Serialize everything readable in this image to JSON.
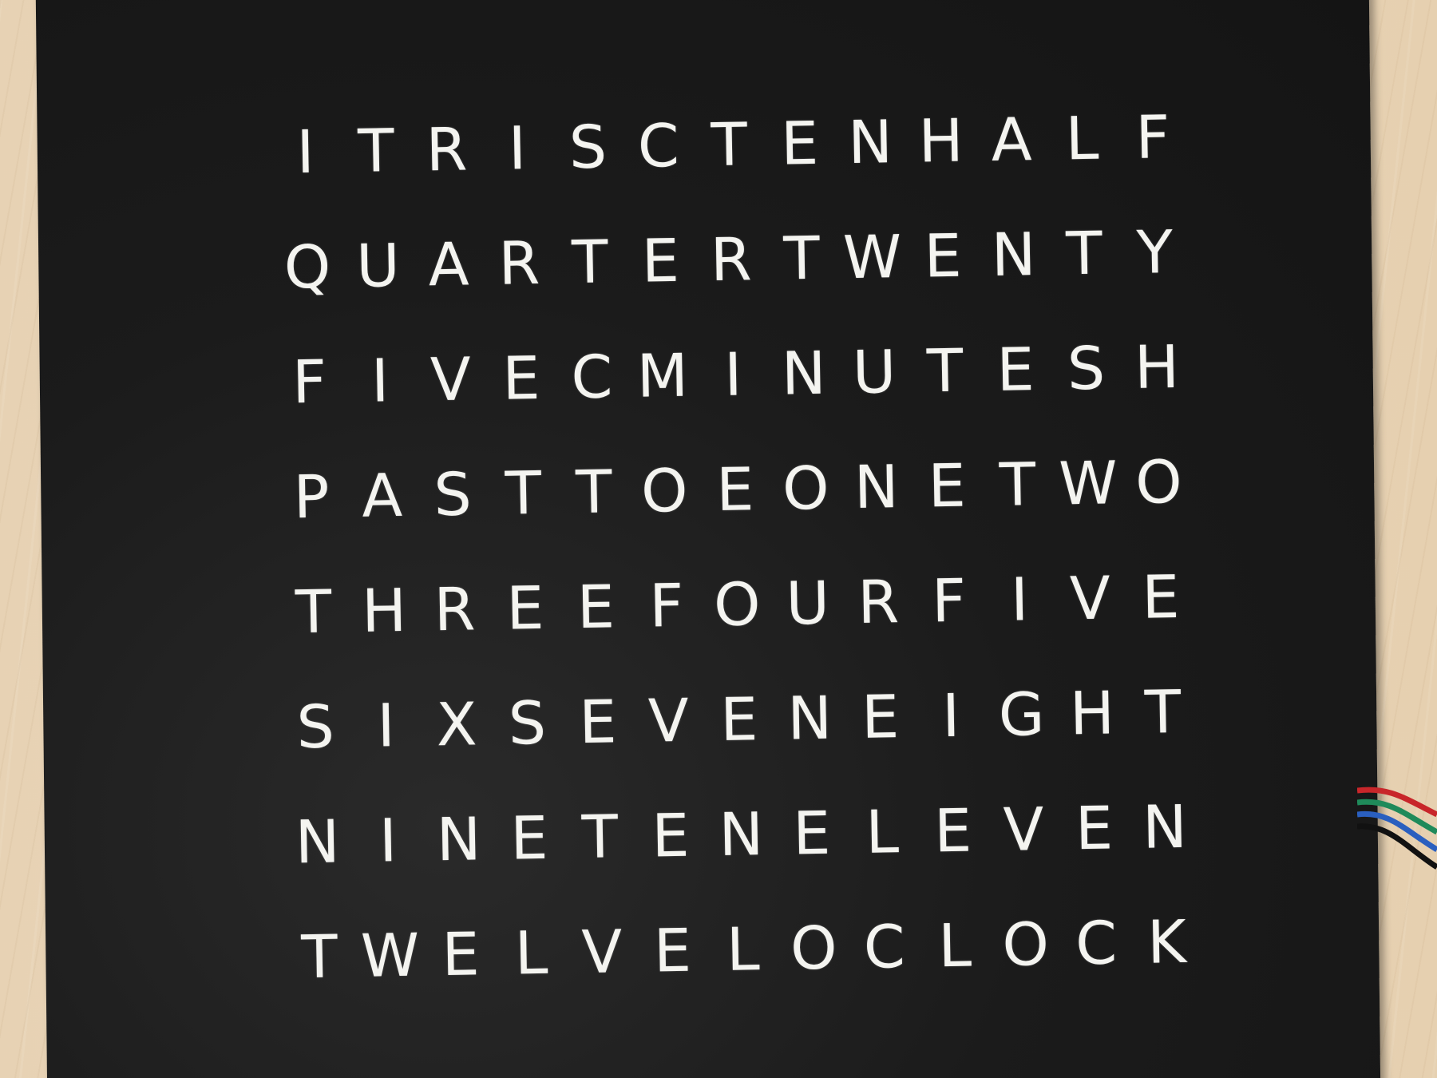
{
  "scene": {
    "description_colors": {
      "panel": "#1b1b1b",
      "letters": "#f4f4f0",
      "table": "#e7d2b4"
    },
    "wire_colors": [
      "#c8262a",
      "#1f8a5a",
      "#2a5fbf",
      "#111111"
    ]
  },
  "clock": {
    "rows": [
      [
        "I",
        "T",
        "R",
        "I",
        "S",
        "C",
        "T",
        "E",
        "N",
        "H",
        "A",
        "L",
        "F"
      ],
      [
        "Q",
        "U",
        "A",
        "R",
        "T",
        "E",
        "R",
        "T",
        "W",
        "E",
        "N",
        "T",
        "Y"
      ],
      [
        "F",
        "I",
        "V",
        "E",
        "C",
        "M",
        "I",
        "N",
        "U",
        "T",
        "E",
        "S",
        "H"
      ],
      [
        "P",
        "A",
        "S",
        "T",
        "T",
        "O",
        "E",
        "O",
        "N",
        "E",
        "T",
        "W",
        "O"
      ],
      [
        "T",
        "H",
        "R",
        "E",
        "E",
        "F",
        "O",
        "U",
        "R",
        "F",
        "I",
        "V",
        "E"
      ],
      [
        "S",
        "I",
        "X",
        "S",
        "E",
        "V",
        "E",
        "N",
        "E",
        "I",
        "G",
        "H",
        "T"
      ],
      [
        "N",
        "I",
        "N",
        "E",
        "T",
        "E",
        "N",
        "E",
        "L",
        "E",
        "V",
        "E",
        "N"
      ],
      [
        "T",
        "W",
        "E",
        "L",
        "V",
        "E",
        "L",
        "O",
        "C",
        "L",
        "O",
        "C",
        "K"
      ]
    ]
  }
}
